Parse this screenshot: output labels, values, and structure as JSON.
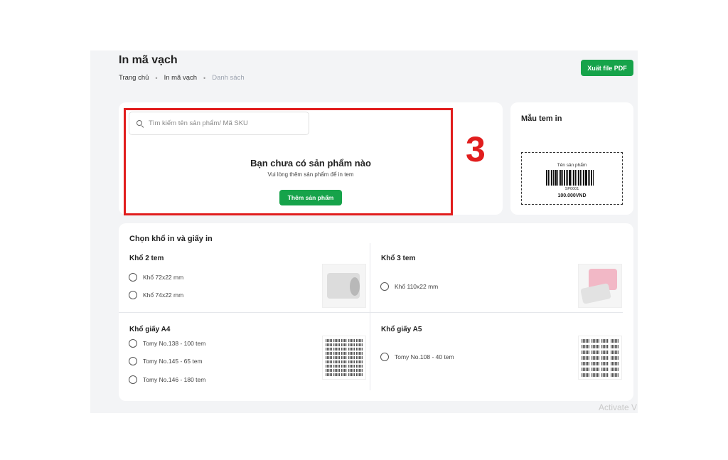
{
  "page": {
    "title": "In mã vạch",
    "breadcrumb": [
      "Trang chủ",
      "In mã vạch",
      "Danh sách"
    ],
    "export_label": "Xuất file PDF"
  },
  "search": {
    "placeholder": "Tìm kiếm tên sản phẩm/ Mã SKU"
  },
  "empty": {
    "title": "Bạn chưa có sản phẩm nào",
    "subtitle": "Vui lòng thêm sản phẩm để in tem",
    "add_label": "Thêm sản phẩm"
  },
  "template": {
    "title": "Mẫu tem in",
    "product_name": "Tên sản phẩm",
    "sku": "SP0001",
    "price": "100.000VND"
  },
  "options": {
    "title": "Chọn khổ in và giấy in",
    "groups": [
      {
        "title": "Khổ 2 tem",
        "items": [
          "Khổ 72x22 mm",
          "Khổ 74x22 mm"
        ]
      },
      {
        "title": "Khổ 3 tem",
        "items": [
          "Khổ 110x22 mm"
        ]
      },
      {
        "title": "Khổ giấy A4",
        "items": [
          "Tomy No.138 - 100 tem",
          "Tomy No.145 - 65 tem",
          "Tomy No.146 - 180 tem"
        ]
      },
      {
        "title": "Khổ giấy A5",
        "items": [
          "Tomy No.108 - 40 tem"
        ]
      }
    ]
  },
  "annotation": {
    "step": "3",
    "color": "#e11d1d"
  },
  "watermark": "Activate V",
  "colors": {
    "accent": "#16a34a"
  }
}
